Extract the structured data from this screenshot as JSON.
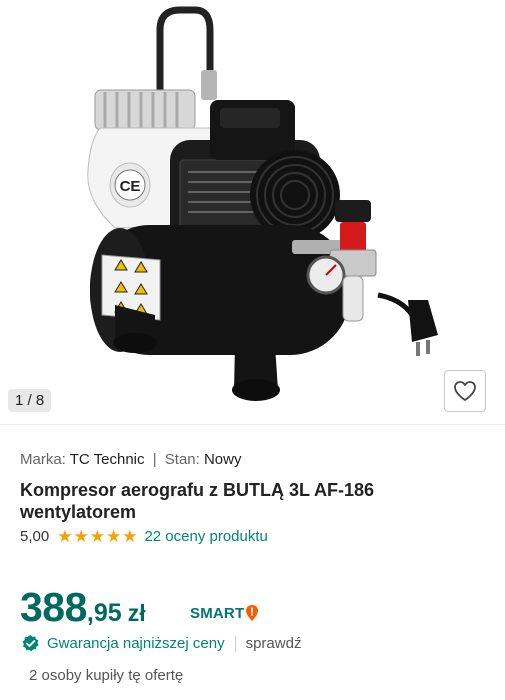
{
  "gallery": {
    "counter": "1 / 8",
    "image_alt": "Kompresor aerografu z butlą 3L",
    "favorite_icon": "heart-outline-icon",
    "product_label_ce": "CE"
  },
  "meta": {
    "brand_label": "Marka:",
    "brand_value": "TC Technic",
    "separator": "|",
    "condition_label": "Stan:",
    "condition_value": "Nowy"
  },
  "product": {
    "title": "Kompresor aerografu z BUTLĄ 3L AF-186 wentylatorem"
  },
  "rating": {
    "score": "5,00",
    "stars": 5,
    "reviews_text": "22 oceny produktu"
  },
  "price": {
    "integer": "388",
    "decimal": ",95",
    "currency": "zł",
    "badge": "SMART"
  },
  "guarantee": {
    "label": "Gwarancja najniższej ceny",
    "action": "sprawdź"
  },
  "social_proof": {
    "text": "2 osoby kupiły tę ofertę"
  },
  "colors": {
    "price": "#006a5e",
    "link": "#008673",
    "star": "#f5a300",
    "smart_accent": "#ff5a00"
  }
}
